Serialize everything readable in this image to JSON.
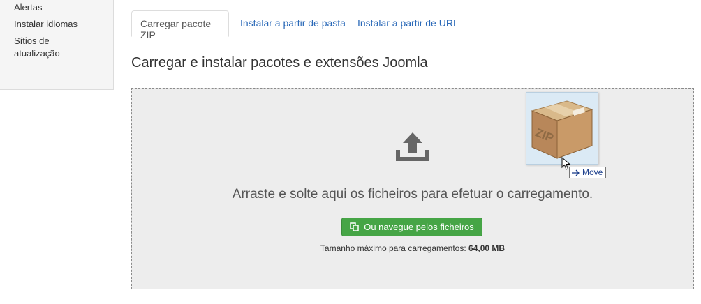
{
  "sidebar": {
    "items": [
      {
        "label": "Alertas"
      },
      {
        "label": "Instalar idiomas"
      },
      {
        "label": "Sítios de atualização"
      }
    ]
  },
  "tabs": [
    {
      "label": "Carregar pacote ZIP",
      "active": true
    },
    {
      "label": "Instalar a partir de pasta",
      "active": false
    },
    {
      "label": "Instalar a partir de URL",
      "active": false
    }
  ],
  "main": {
    "title": "Carregar e instalar pacotes e extensões Joomla",
    "drop_message": "Arraste e solte aqui os ficheiros para efetuar o carregamento.",
    "browse_label": "Ou navegue pelos ficheiros",
    "max_size_label": "Tamanho máximo para carregamentos:",
    "max_size_value": "64,00 MB"
  },
  "drag": {
    "file_icon": "zip-package-icon",
    "package_text": "ZIP",
    "action_label": "Move"
  },
  "colors": {
    "accent_link": "#2a69b8",
    "button_green": "#46a546",
    "dropzone_bg": "#ededed"
  }
}
